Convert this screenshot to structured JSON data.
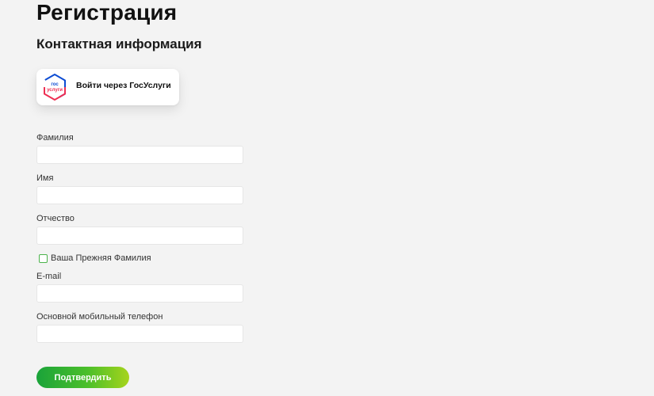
{
  "page": {
    "title": "Регистрация",
    "section_title": "Контактная информация"
  },
  "gosuslugi": {
    "logo_text_top": "гос",
    "logo_text_bottom": "услуги",
    "label": "Войти через ГосУслуги",
    "logo_colors": {
      "blue": "#0d4cd3",
      "red": "#ee2f53"
    }
  },
  "form": {
    "fields": [
      {
        "label": "Фамилия",
        "value": "",
        "placeholder": ""
      },
      {
        "label": "Имя",
        "value": "",
        "placeholder": ""
      },
      {
        "label": "Отчество",
        "value": "",
        "placeholder": ""
      }
    ],
    "checkbox": {
      "label": "Ваша Прежняя Фамилия",
      "checked": false
    },
    "fields_after": [
      {
        "label": "E-mail",
        "value": "",
        "placeholder": ""
      },
      {
        "label": "Основной мобильный телефон",
        "value": "",
        "placeholder": ""
      }
    ],
    "submit_label": "Подтвердить"
  },
  "colors": {
    "background": "#f3f3f3",
    "accent_green_start": "#1aa33a",
    "accent_green_end": "#a6d41c",
    "checkbox_border": "#4bb34b"
  }
}
